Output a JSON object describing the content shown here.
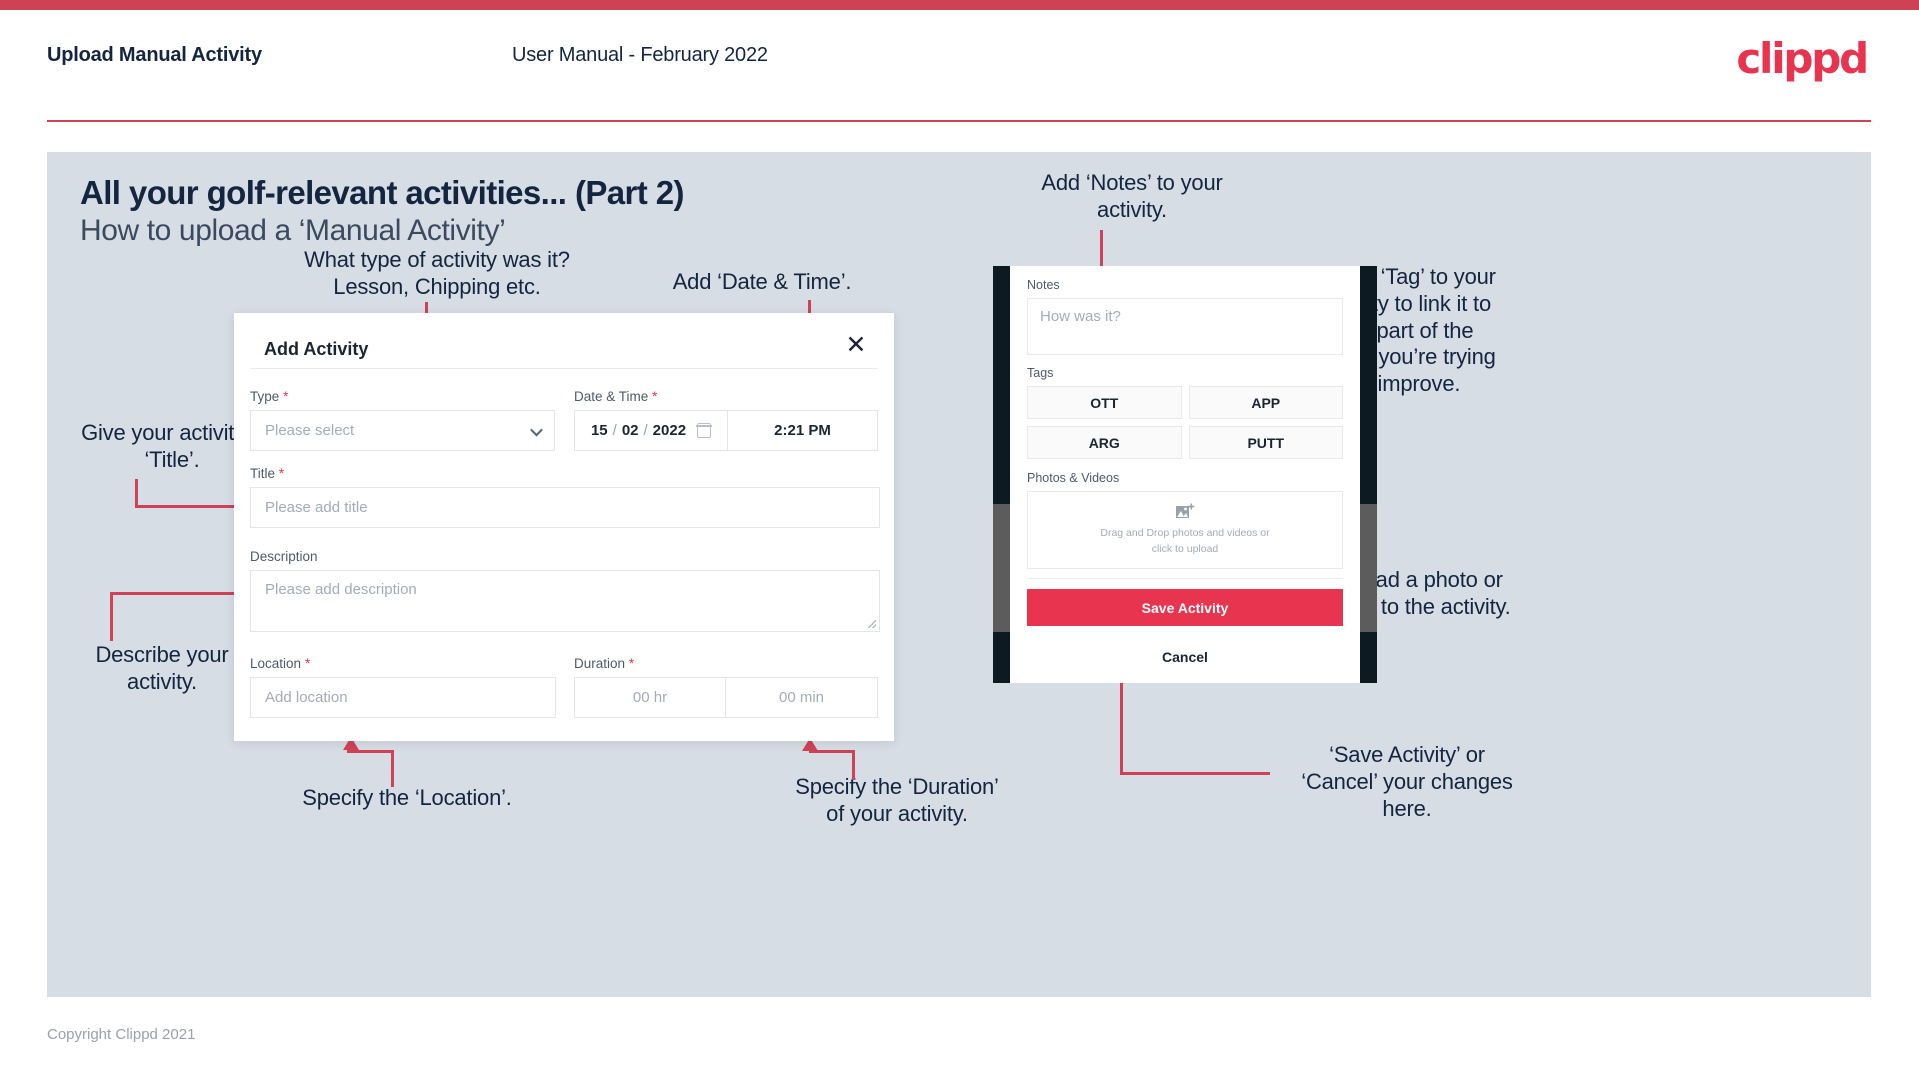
{
  "header": {
    "title": "Upload Manual Activity",
    "subtitle": "User Manual - February 2022",
    "logo": "clippd"
  },
  "slide": {
    "title": "All your golf-relevant activities... (Part 2)",
    "subtitle": "How to upload a ‘Manual Activity’"
  },
  "footer": {
    "copyright": "Copyright Clippd 2021"
  },
  "dialog": {
    "title": "Add Activity",
    "close_label": "✕",
    "fields": {
      "type": {
        "label": "Type",
        "required": "*",
        "placeholder": "Please select"
      },
      "datetime": {
        "label": "Date & Time",
        "required": "*",
        "day": "15",
        "month": "02",
        "year": "2022",
        "sep1": "/",
        "sep2": "/",
        "time": "2:21 PM"
      },
      "title": {
        "label": "Title",
        "required": "*",
        "placeholder": "Please add title"
      },
      "description": {
        "label": "Description",
        "placeholder": "Please add description"
      },
      "location": {
        "label": "Location",
        "required": "*",
        "placeholder": "Add location"
      },
      "duration": {
        "label": "Duration",
        "required": "*",
        "hours": "00 hr",
        "minutes": "00 min"
      }
    }
  },
  "mobile": {
    "notes": {
      "label": "Notes",
      "placeholder": "How was it?"
    },
    "tags": {
      "label": "Tags",
      "items": [
        "OTT",
        "APP",
        "ARG",
        "PUTT"
      ]
    },
    "photos": {
      "label": "Photos & Videos",
      "caption_line1": "Drag and Drop photos and videos or",
      "caption_line2": "click to upload"
    },
    "save_label": "Save Activity",
    "cancel_label": "Cancel"
  },
  "annotations": {
    "type": "What type of activity was it?\nLesson, Chipping etc.",
    "datetime": "Add ‘Date & Time’.",
    "title": "Give your activity a\n‘Title’.",
    "description": "Describe your\nactivity.",
    "location": "Specify the ‘Location’.",
    "duration": "Specify the ‘Duration’\nof your activity.",
    "notes": "Add ‘Notes’ to your\nactivity.",
    "tags": "Add a ‘Tag’ to your\nactivity to link it to\nthe part of the\ngame you’re trying\nto improve.",
    "photos": "Upload a photo or\nvideo to the activity.",
    "save": "‘Save Activity’ or\n‘Cancel’ your changes\nhere."
  },
  "colors": {
    "brand_red": "#e8344e",
    "bar_red": "#cf4256",
    "slide_bg": "#d7dde5",
    "ink": "#13253f"
  }
}
